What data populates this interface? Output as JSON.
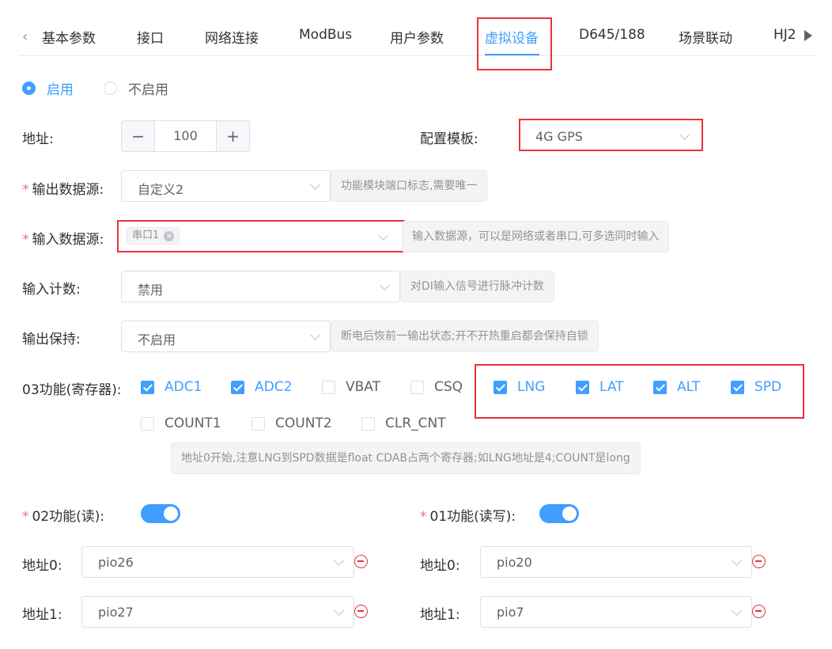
{
  "tabs": [
    "基本参数",
    "接口",
    "网络连接",
    "ModBus",
    "用户参数",
    "虚拟设备",
    "D645/188",
    "场景联动",
    "HJ2"
  ],
  "enable_radio": {
    "on_label": "启用",
    "off_label": "不启用"
  },
  "address": {
    "label": "地址:",
    "value": "100",
    "minus": "−",
    "plus": "+"
  },
  "template": {
    "label": "配置模板:",
    "value": "4G GPS"
  },
  "output_source": {
    "required": "*",
    "label": "输出数据源:",
    "value": "自定义2",
    "hint": "功能模块端口标志,需要唯一"
  },
  "input_source": {
    "required": "*",
    "label": "输入数据源:",
    "tag": "串口1",
    "tag_close": "×",
    "hint": "输入数据源，可以是网络或者串口,可多选同时输入"
  },
  "input_count": {
    "label": "输入计数:",
    "value": "禁用",
    "hint": "对DI输入信号进行脉冲计数"
  },
  "output_hold": {
    "label": "输出保持:",
    "value": "不启用",
    "hint": "断电后恢前一输出状态;开不开热重启都会保持自锁"
  },
  "func03": {
    "label": "03功能(寄存器):",
    "options": [
      {
        "label": "ADC1",
        "checked": true
      },
      {
        "label": "ADC2",
        "checked": true
      },
      {
        "label": "VBAT",
        "checked": false
      },
      {
        "label": "CSQ",
        "checked": false
      },
      {
        "label": "LNG",
        "checked": true
      },
      {
        "label": "LAT",
        "checked": true
      },
      {
        "label": "ALT",
        "checked": true
      },
      {
        "label": "SPD",
        "checked": true
      },
      {
        "label": "COUNT1",
        "checked": false
      },
      {
        "label": "COUNT2",
        "checked": false
      },
      {
        "label": "CLR_CNT",
        "checked": false
      }
    ],
    "hint": "地址0开始,注意LNG到SPD数据是float CDAB占两个寄存器;如LNG地址是4;COUNT是long"
  },
  "func02": {
    "required": "*",
    "label": "02功能(读):",
    "enabled": true,
    "rows": [
      {
        "label": "地址0:",
        "value": "pio26"
      },
      {
        "label": "地址1:",
        "value": "pio27"
      }
    ]
  },
  "func01": {
    "required": "*",
    "label": "01功能(读写):",
    "enabled": true,
    "rows": [
      {
        "label": "地址0:",
        "value": "pio20"
      },
      {
        "label": "地址1:",
        "value": "pio7"
      }
    ]
  },
  "colors": {
    "primary": "#409eff",
    "highlight": "#e8333a",
    "required": "#f56c6c"
  }
}
